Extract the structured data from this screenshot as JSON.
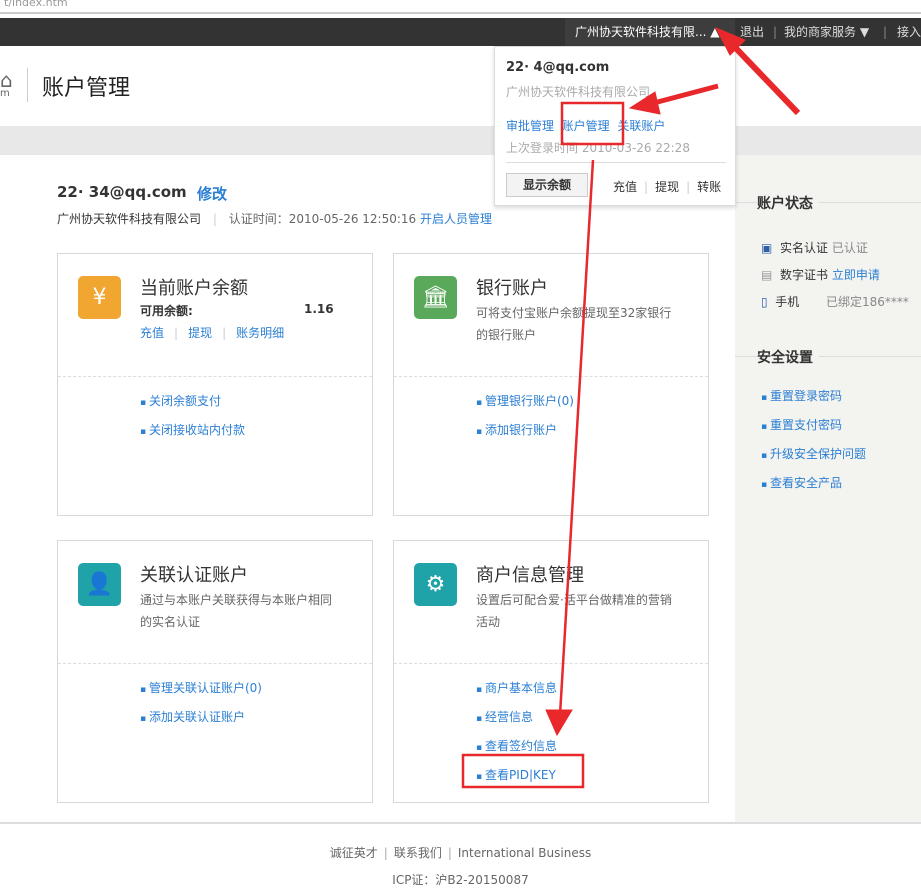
{
  "browser": {
    "url": "t/index.htm"
  },
  "topbar": {
    "company": "广州协天软件科技有限...",
    "logout": "退出",
    "merchant_services": "我的商家服务",
    "access": "接入"
  },
  "header": {
    "logo_text": "m",
    "title": "账户管理"
  },
  "dropdown": {
    "email": "22·   4@qq.com",
    "company": "广州协天软件科技有限公司",
    "links": [
      "审批管理",
      "账户管理",
      "关联账户"
    ],
    "last_login": "上次登录时间 2010-03-26 22:28",
    "show_balance": "显示余额",
    "actions": [
      "充值",
      "提现",
      "转账"
    ]
  },
  "account": {
    "email": "22·    34@qq.com",
    "edit": "修改",
    "company": "广州协天软件科技有限公司",
    "cert_time": "认证时间：2010-05-26 12:50:16",
    "staff_link": "开启人员管理"
  },
  "cards": [
    {
      "title": "当前账户余额",
      "balance_label": "可用余额:",
      "balance": "1.16",
      "links": [
        "充值",
        "提现",
        "账务明细"
      ],
      "items": [
        "关闭余额支付",
        "关闭接收站内付款"
      ]
    },
    {
      "title": "银行账户",
      "desc": "可将支付宝账户余额提现至32家银行的银行账户",
      "items": [
        "管理银行账户(0)",
        "添加银行账户"
      ]
    },
    {
      "title": "关联认证账户",
      "desc": "通过与本账户关联获得与本账户相同的实名认证",
      "items": [
        "管理关联认证账户(0)",
        "添加关联认证账户"
      ]
    },
    {
      "title": "商户信息管理",
      "desc": "设置后可配合爱·活平台做精准的营销活动",
      "items": [
        "商户基本信息",
        "经营信息",
        "查看签约信息",
        "查看PID|KEY"
      ]
    }
  ],
  "sidebar": {
    "status_title": "账户状态",
    "status": [
      {
        "label": "实名认证",
        "value": "已认证"
      },
      {
        "label": "数字证书",
        "value": "立即申请"
      },
      {
        "label": "手机",
        "value": "已绑定186****"
      }
    ],
    "security_title": "安全设置",
    "security_links": [
      "重置登录密码",
      "重置支付密码",
      "升级安全保护问题",
      "查看安全产品"
    ]
  },
  "footer": {
    "links": [
      "诚征英才",
      "联系我们",
      "International Business"
    ],
    "icp": "ICP证：沪B2-20150087"
  },
  "colors": {
    "link": "#2b7fd3",
    "annotation": "#e8282b"
  }
}
